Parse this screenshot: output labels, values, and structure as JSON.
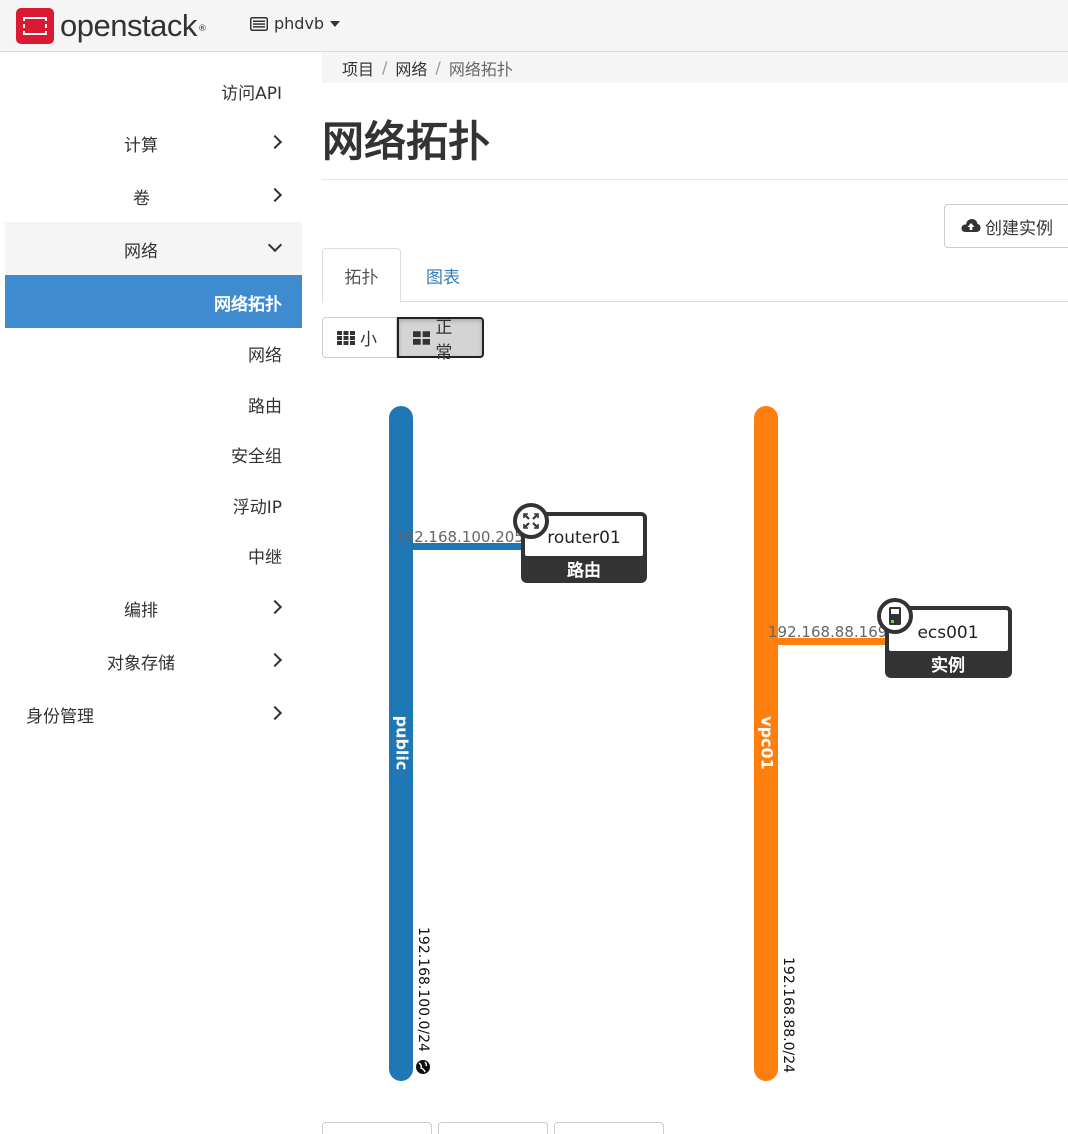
{
  "brand": {
    "name": "openstack",
    "reg": "®"
  },
  "project": {
    "name": "phdvb"
  },
  "sidebar": {
    "items": [
      {
        "label": "访问API"
      },
      {
        "label": "计算"
      },
      {
        "label": "卷"
      },
      {
        "label": "网络"
      },
      {
        "label": "网络拓扑"
      },
      {
        "label": "网络"
      },
      {
        "label": "路由"
      },
      {
        "label": "安全组"
      },
      {
        "label": "浮动IP"
      },
      {
        "label": "中继"
      },
      {
        "label": "编排"
      },
      {
        "label": "对象存储"
      },
      {
        "label": "身份管理"
      }
    ]
  },
  "breadcrumb": {
    "item1": "项目",
    "item2": "网络",
    "current": "网络拓扑",
    "sep": "/"
  },
  "page": {
    "title": "网络拓扑"
  },
  "actions": {
    "create_instance": "创建实例"
  },
  "tabs": {
    "topology": "拓扑",
    "graph": "图表"
  },
  "view_size": {
    "small": "小",
    "normal": "正常"
  },
  "topology": {
    "networks": [
      {
        "name": "public",
        "cidr": "192.168.100.0/24",
        "color": "#1f77b4",
        "external": true
      },
      {
        "name": "vpc01",
        "cidr": "192.168.88.0/24",
        "color": "#ff7f0e",
        "external": false
      }
    ],
    "devices": [
      {
        "name": "router01",
        "type": "路由",
        "ip": "192.168.100.205",
        "icon": "router-icon"
      },
      {
        "name": "ecs001",
        "type": "实例",
        "ip": "192.168.88.169",
        "icon": "server-icon"
      }
    ]
  },
  "colors": {
    "active_nav": "#3e8ccf",
    "link": "#337ab7",
    "brand_red": "#da1a32"
  }
}
